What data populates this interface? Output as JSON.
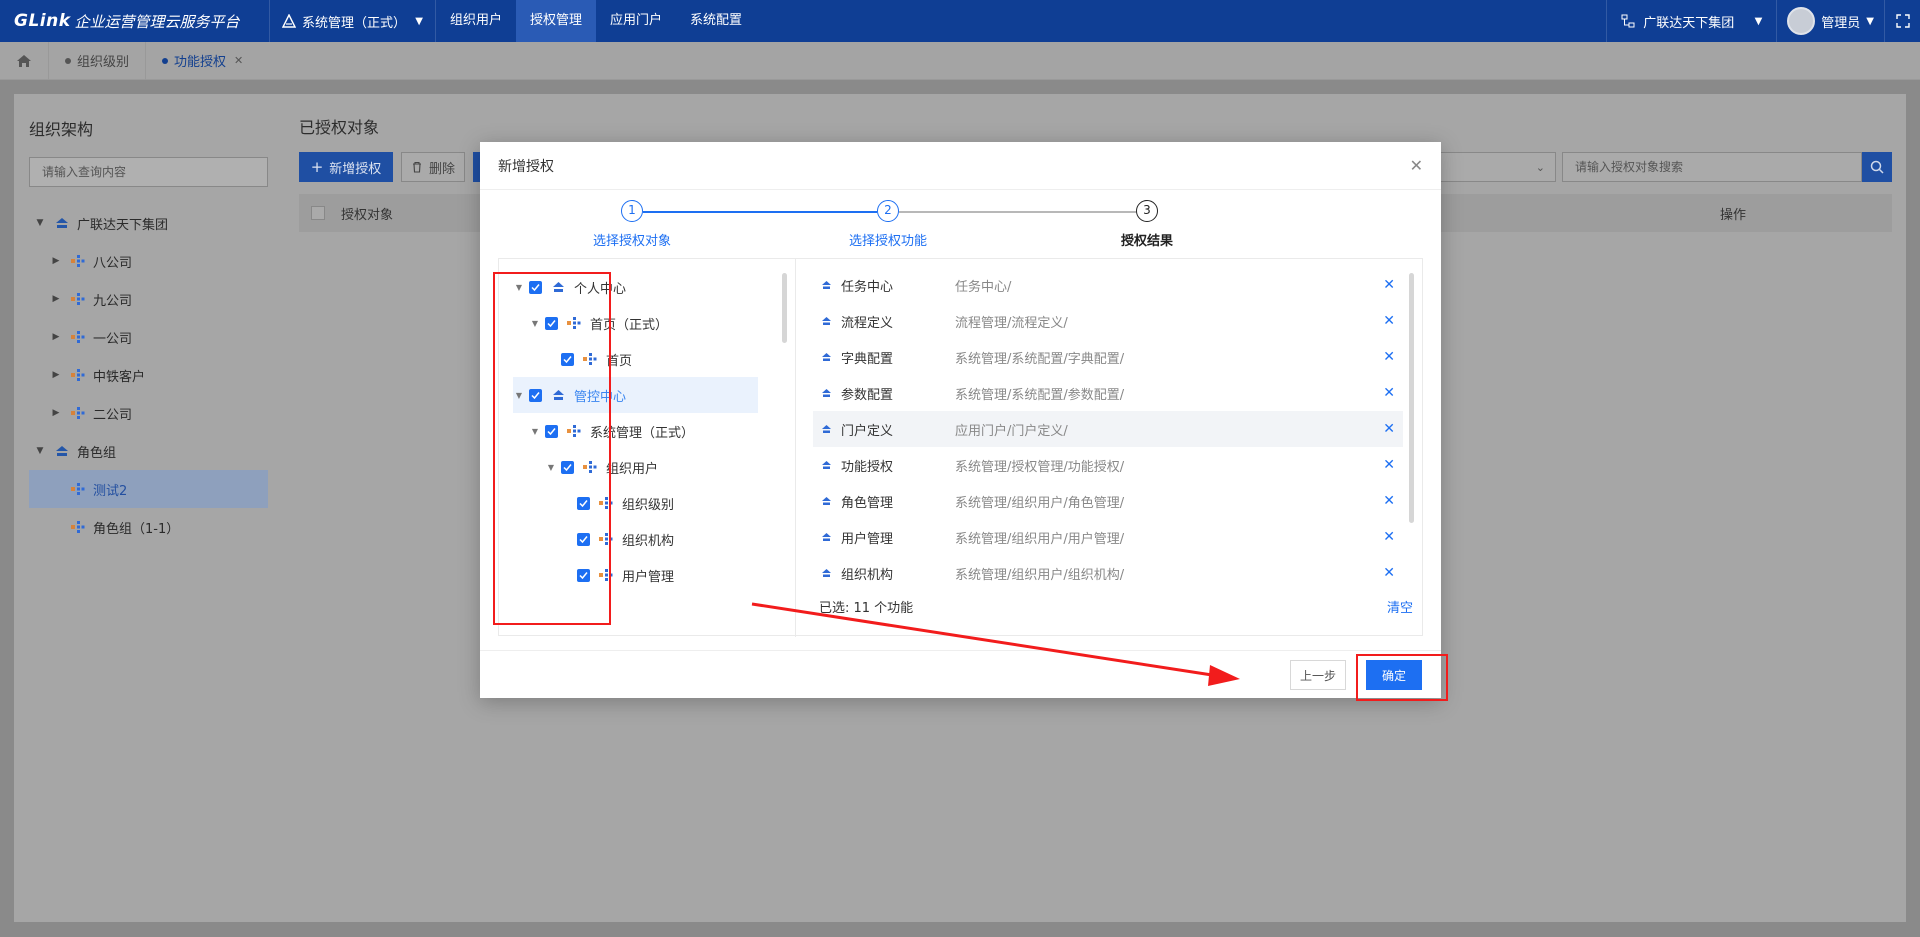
{
  "topbar": {
    "logo_mark": "GLink",
    "logo_text": "企业运营管理云服务平台",
    "system_select": "系统管理（正式）",
    "nav": [
      {
        "label": "组织用户",
        "active": false
      },
      {
        "label": "授权管理",
        "active": true
      },
      {
        "label": "应用门户",
        "active": false
      },
      {
        "label": "系统配置",
        "active": false
      }
    ],
    "org": "广联达天下集团",
    "user": "管理员"
  },
  "tabs": [
    {
      "label": "组织级别",
      "active": false,
      "closable": false
    },
    {
      "label": "功能授权",
      "active": true,
      "closable": true
    }
  ],
  "left": {
    "title": "组织架构",
    "search_placeholder": "请输入查询内容",
    "tree": [
      {
        "label": "广联达天下集团",
        "level": 0,
        "expanded": true,
        "icon": "org-root-icon",
        "selected": false
      },
      {
        "label": "八公司",
        "level": 1,
        "expanded": false,
        "icon": "org-node-icon",
        "selected": false
      },
      {
        "label": "九公司",
        "level": 1,
        "expanded": false,
        "icon": "org-node-icon",
        "selected": false
      },
      {
        "label": "一公司",
        "level": 1,
        "expanded": false,
        "icon": "org-node-icon",
        "selected": false
      },
      {
        "label": "中铁客户",
        "level": 1,
        "expanded": false,
        "icon": "org-node-icon",
        "selected": false
      },
      {
        "label": "二公司",
        "level": 1,
        "expanded": false,
        "icon": "org-node-icon",
        "selected": false
      },
      {
        "label": "角色组",
        "level": 0,
        "expanded": true,
        "icon": "org-root-icon",
        "selected": false
      },
      {
        "label": "测试2",
        "level": 1,
        "expanded": null,
        "icon": "org-node-icon",
        "selected": true
      },
      {
        "label": "角色组（1-1）",
        "level": 1,
        "expanded": null,
        "icon": "org-node-icon",
        "selected": false
      }
    ]
  },
  "main": {
    "title": "已授权对象",
    "add_button": "新增授权",
    "delete_button": "删除",
    "search_placeholder": "请输入授权对象搜索",
    "col_object": "授权对象",
    "col_action": "操作"
  },
  "modal": {
    "title": "新增授权",
    "steps": [
      {
        "num": "1",
        "label": "选择授权对象",
        "state": "done"
      },
      {
        "num": "2",
        "label": "选择授权功能",
        "state": "done"
      },
      {
        "num": "3",
        "label": "授权结果",
        "state": "current"
      }
    ],
    "func_tree": [
      {
        "label": "个人中心",
        "level": 0,
        "arrow": true,
        "icon": "module-icon",
        "highlight": false
      },
      {
        "label": "首页（正式）",
        "level": 1,
        "arrow": true,
        "icon": "app-icon",
        "highlight": false
      },
      {
        "label": "首页",
        "level": 2,
        "arrow": false,
        "icon": "app-icon",
        "highlight": false
      },
      {
        "label": "管控中心",
        "level": 0,
        "arrow": true,
        "icon": "module-icon",
        "highlight": true
      },
      {
        "label": "系统管理（正式）",
        "level": 1,
        "arrow": true,
        "icon": "app-icon",
        "highlight": false
      },
      {
        "label": "组织用户",
        "level": 2,
        "arrow": true,
        "icon": "app-icon",
        "highlight": false
      },
      {
        "label": "组织级别",
        "level": 3,
        "arrow": false,
        "icon": "app-icon",
        "highlight": false
      },
      {
        "label": "组织机构",
        "level": 3,
        "arrow": false,
        "icon": "app-icon",
        "highlight": false
      },
      {
        "label": "用户管理",
        "level": 3,
        "arrow": false,
        "icon": "app-icon",
        "highlight": false
      }
    ],
    "selected": [
      {
        "name": "任务中心",
        "path": "任务中心/",
        "highlight": false
      },
      {
        "name": "流程定义",
        "path": "流程管理/流程定义/",
        "highlight": false
      },
      {
        "name": "字典配置",
        "path": "系统管理/系统配置/字典配置/",
        "highlight": false
      },
      {
        "name": "参数配置",
        "path": "系统管理/系统配置/参数配置/",
        "highlight": false
      },
      {
        "name": "门户定义",
        "path": "应用门户/门户定义/",
        "highlight": true
      },
      {
        "name": "功能授权",
        "path": "系统管理/授权管理/功能授权/",
        "highlight": false
      },
      {
        "name": "角色管理",
        "path": "系统管理/组织用户/角色管理/",
        "highlight": false
      },
      {
        "name": "用户管理",
        "path": "系统管理/组织用户/用户管理/",
        "highlight": false
      },
      {
        "name": "组织机构",
        "path": "系统管理/组织用户/组织机构/",
        "highlight": false
      }
    ],
    "selected_count": "已选: 11 个功能",
    "clear": "清空",
    "prev_button": "上一步",
    "ok_button": "确定"
  },
  "colors": {
    "topbar": "#0f3e94",
    "primary": "#1d6ff2",
    "annotation": "#f21c1c"
  }
}
